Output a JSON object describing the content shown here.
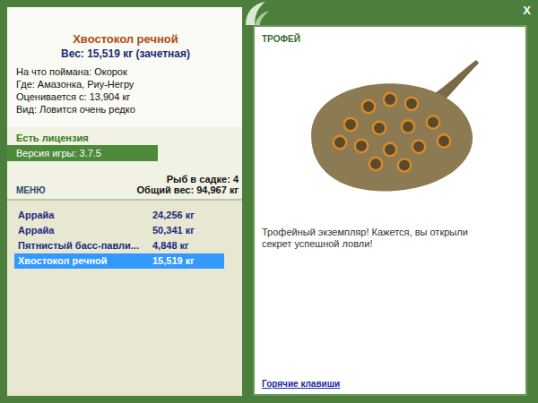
{
  "card": {
    "title": "Хвостокол речной",
    "weight": "Вес: 15,519 кг (зачетная)",
    "details": [
      "На что поймана: Окорок",
      "Где: Амазонка, Риу-Негру",
      "Оценивается с: 13,904 кг",
      "Вид: Ловится очень редко"
    ]
  },
  "license": "Есть лицензия",
  "version": "Версия игры: 3.7.5",
  "menu_button": "МЕНЮ",
  "keepnet": {
    "count": "Рыб в садке: 4",
    "total": "Общий вес: 94,967 кг"
  },
  "catch_list": [
    {
      "name": "Аррайа",
      "weight": "24,256 кг",
      "selected": false
    },
    {
      "name": "Аррайа",
      "weight": "50,341 кг",
      "selected": false
    },
    {
      "name": "Пятнистый басс-павли...",
      "weight": "4,848 кг",
      "selected": false
    },
    {
      "name": "Хвостокол речной",
      "weight": "15,519 кг",
      "selected": true
    }
  ],
  "trophy": {
    "heading": "ТРОФЕЙ",
    "message": "Трофейный экземпляр! Кажется, вы открыли секрет успешной ловли!"
  },
  "hotkeys_link": "Горячие клавиши",
  "close": "X"
}
